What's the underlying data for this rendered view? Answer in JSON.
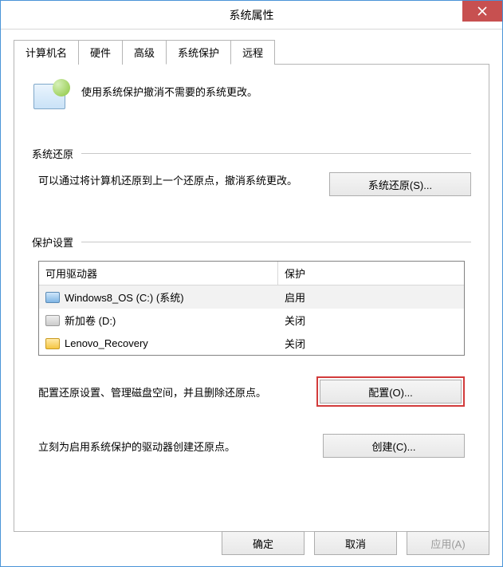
{
  "window": {
    "title": "系统属性"
  },
  "tabs": [
    {
      "label": "计算机名",
      "active": false
    },
    {
      "label": "硬件",
      "active": false
    },
    {
      "label": "高级",
      "active": false
    },
    {
      "label": "系统保护",
      "active": true
    },
    {
      "label": "远程",
      "active": false
    }
  ],
  "intro": "使用系统保护撤消不需要的系统更改。",
  "section_restore": {
    "title": "系统还原",
    "desc": "可以通过将计算机还原到上一个还原点，撤消系统更改。",
    "button": "系统还原(S)..."
  },
  "section_protect": {
    "title": "保护设置",
    "col_drive": "可用驱动器",
    "col_prot": "保护",
    "rows": [
      {
        "icon": "drive",
        "name": "Windows8_OS (C:) (系统)",
        "status": "启用",
        "selected": true
      },
      {
        "icon": "drive-gray",
        "name": "新加卷 (D:)",
        "status": "关闭",
        "selected": false
      },
      {
        "icon": "folder",
        "name": "Lenovo_Recovery",
        "status": "关闭",
        "selected": false
      }
    ],
    "config_desc": "配置还原设置、管理磁盘空间，并且删除还原点。",
    "config_button": "配置(O)...",
    "create_desc": "立刻为启用系统保护的驱动器创建还原点。",
    "create_button": "创建(C)..."
  },
  "buttons": {
    "ok": "确定",
    "cancel": "取消",
    "apply": "应用(A)"
  }
}
